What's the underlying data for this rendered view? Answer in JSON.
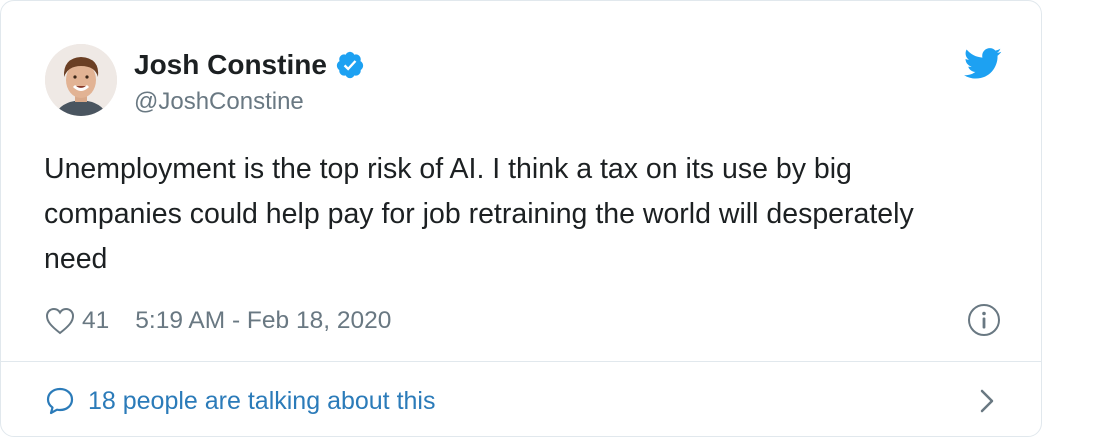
{
  "author": {
    "name": "Josh Constine",
    "handle": "@JoshConstine",
    "verified": true
  },
  "tweet": {
    "text": "Unemployment is the top risk of AI. I think a tax on its use by big companies could help pay for job retraining the world will desperately need",
    "like_count": "41",
    "timestamp": "5:19 AM - Feb 18, 2020"
  },
  "conversation": {
    "label": "18 people are talking about this"
  },
  "icons": {
    "brand": "twitter-bird-icon",
    "badge": "verified-badge-icon",
    "like": "heart-icon",
    "info": "info-icon",
    "reply": "comment-bubble-icon",
    "chevron": "chevron-right-icon"
  },
  "colors": {
    "twitter_blue": "#1da1f2",
    "link_blue": "#2b7bb9",
    "secondary_text": "#697882",
    "primary_text": "#1c2022",
    "border": "#e1e8ed"
  }
}
